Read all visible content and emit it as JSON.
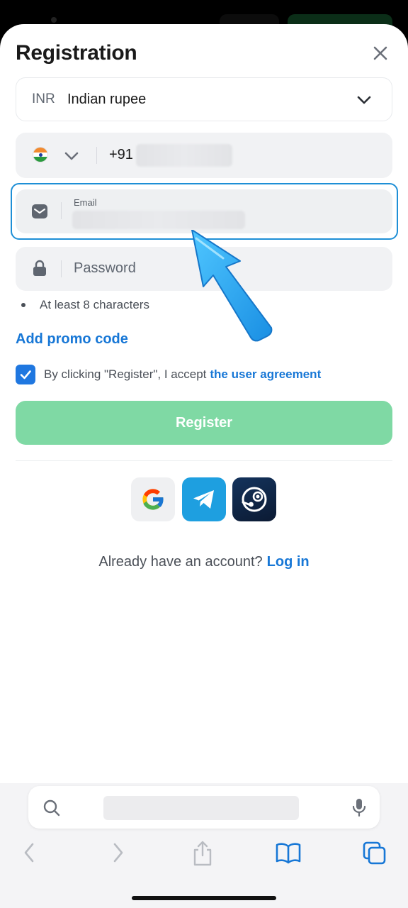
{
  "registration": {
    "title": "Registration",
    "currency": {
      "code": "INR",
      "name": "Indian rupee"
    },
    "phone": {
      "prefix": "+91"
    },
    "email": {
      "label": "Email"
    },
    "password": {
      "placeholder": "Password",
      "hint": "At least 8 characters"
    },
    "promo_label": "Add promo code",
    "agreement": {
      "text": "By clicking \"Register\", I accept",
      "link": "the user agreement",
      "checked": true
    },
    "register_label": "Register",
    "login_prompt": "Already have an account?",
    "login_link": "Log in",
    "social": [
      "google-icon",
      "telegram-icon",
      "steam-icon"
    ]
  },
  "colors": {
    "accent": "#1777d6",
    "register_button": "#7fd9a4",
    "focus_border": "#1e8fd6",
    "telegram": "#1e9fe0",
    "steam": "#14335c"
  }
}
